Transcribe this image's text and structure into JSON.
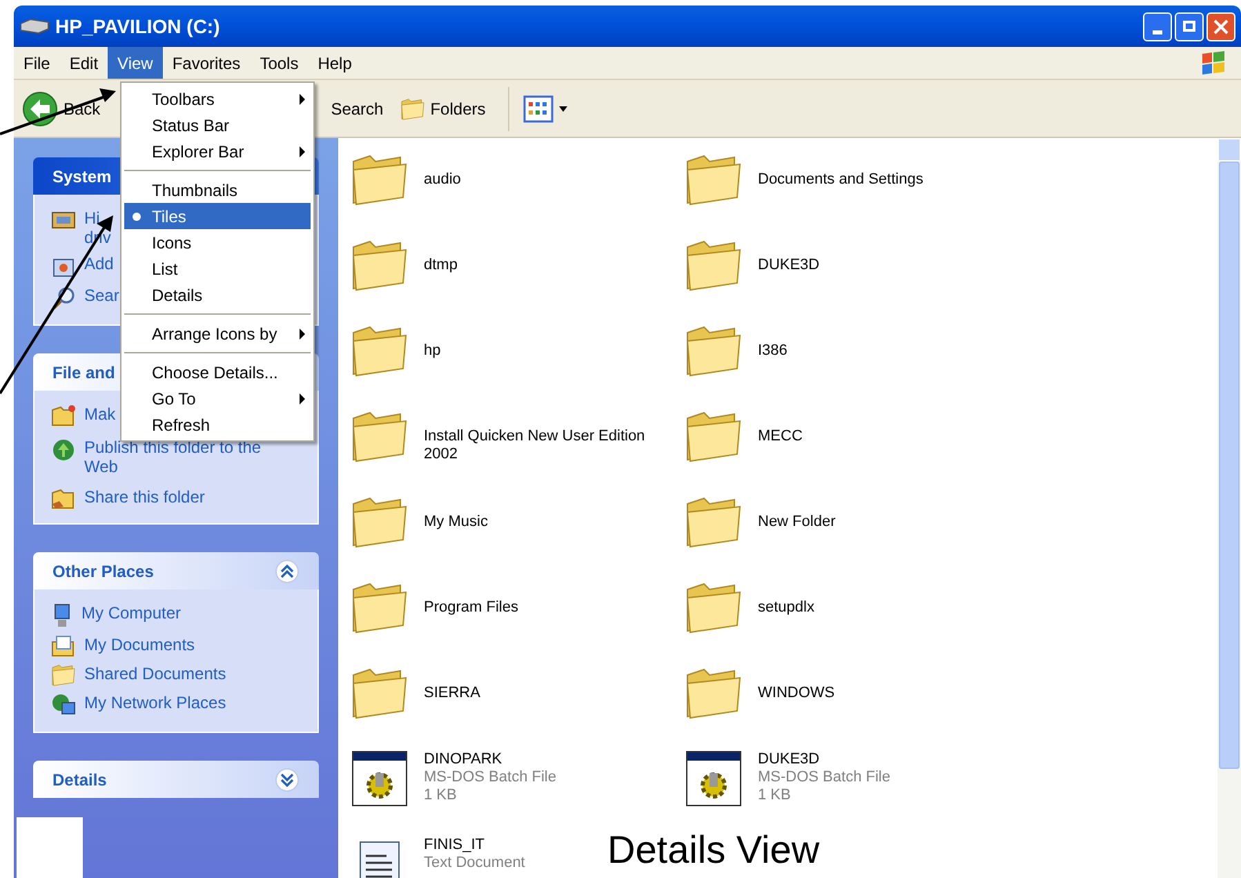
{
  "window": {
    "title": "HP_PAVILION (C:)"
  },
  "menu_bar": [
    {
      "label": "File",
      "selected": false
    },
    {
      "label": "Edit",
      "selected": false
    },
    {
      "label": "View",
      "selected": true
    },
    {
      "label": "Favorites",
      "selected": false
    },
    {
      "label": "Tools",
      "selected": false
    },
    {
      "label": "Help",
      "selected": false
    }
  ],
  "toolbar": [
    {
      "kind": "back",
      "label": "Back"
    },
    {
      "kind": "search",
      "label": "Search"
    },
    {
      "kind": "folders",
      "label": "Folders"
    },
    {
      "kind": "views"
    }
  ],
  "view_menu": [
    {
      "kind": "item",
      "label": "Toolbars",
      "submenu": true,
      "selected": false
    },
    {
      "kind": "item",
      "label": "Status Bar",
      "submenu": false,
      "selected": false
    },
    {
      "kind": "item",
      "label": "Explorer Bar",
      "submenu": true,
      "selected": false
    },
    {
      "kind": "separator"
    },
    {
      "kind": "item",
      "label": "Thumbnails",
      "submenu": false,
      "selected": false
    },
    {
      "kind": "item",
      "label": "Tiles",
      "submenu": false,
      "selected": true
    },
    {
      "kind": "item",
      "label": "Icons",
      "submenu": false,
      "selected": false
    },
    {
      "kind": "item",
      "label": "List",
      "submenu": false,
      "selected": false
    },
    {
      "kind": "item",
      "label": "Details",
      "submenu": false,
      "selected": false
    },
    {
      "kind": "separator"
    },
    {
      "kind": "item",
      "label": "Arrange Icons by",
      "submenu": true,
      "selected": false
    },
    {
      "kind": "separator"
    },
    {
      "kind": "item",
      "label": "Choose Details...",
      "submenu": false,
      "selected": false
    },
    {
      "kind": "item",
      "label": "Go To",
      "submenu": true,
      "selected": false
    },
    {
      "kind": "item",
      "label": "Refresh",
      "submenu": false,
      "selected": false
    }
  ],
  "sidebar": [
    {
      "title": "System",
      "items": [
        {
          "kind": "drive",
          "lines": [
            "Hi",
            "driv"
          ]
        },
        {
          "kind": "add",
          "lines": [
            "Add"
          ]
        },
        {
          "kind": "search",
          "lines": [
            "Sear"
          ]
        }
      ]
    },
    {
      "title": "File and",
      "items": [
        {
          "kind": "newfolder",
          "lines": [
            "Mak"
          ]
        },
        {
          "kind": "globe",
          "lines": [
            "Publish this folder to the",
            "Web"
          ]
        },
        {
          "kind": "share",
          "lines": [
            "Share this folder"
          ]
        }
      ]
    },
    {
      "title": "Other Places",
      "expanded": true,
      "items": [
        {
          "kind": "computer",
          "lines": [
            "My Computer"
          ]
        },
        {
          "kind": "documents",
          "lines": [
            "My Documents"
          ]
        },
        {
          "kind": "folder",
          "lines": [
            "Shared Documents"
          ]
        },
        {
          "kind": "network",
          "lines": [
            "My Network Places"
          ]
        }
      ]
    },
    {
      "title": "Details",
      "expanded": false
    }
  ],
  "files": [
    {
      "kind": "folder",
      "name": "audio"
    },
    {
      "kind": "folder",
      "name": "Documents and Settings"
    },
    {
      "kind": "folder",
      "name": "dtmp"
    },
    {
      "kind": "folder",
      "name": "DUKE3D"
    },
    {
      "kind": "folder",
      "name": "hp"
    },
    {
      "kind": "folder",
      "name": "I386"
    },
    {
      "kind": "folder",
      "name": "Install Quicken New User Edition 2002"
    },
    {
      "kind": "folder",
      "name": "MECC"
    },
    {
      "kind": "folder",
      "name": "My Music"
    },
    {
      "kind": "folder",
      "name": "New Folder"
    },
    {
      "kind": "folder",
      "name": "Program Files"
    },
    {
      "kind": "folder",
      "name": "setupdlx"
    },
    {
      "kind": "folder",
      "name": "SIERRA"
    },
    {
      "kind": "folder",
      "name": "WINDOWS"
    },
    {
      "kind": "batch",
      "name": "DINOPARK",
      "type": "MS-DOS Batch File",
      "size": "1 KB"
    },
    {
      "kind": "batch",
      "name": "DUKE3D",
      "type": "MS-DOS Batch File",
      "size": "1 KB"
    },
    {
      "kind": "text",
      "name": "FINIS_IT",
      "type": "Text Document"
    }
  ],
  "annotation": {
    "caption": "Details View"
  }
}
